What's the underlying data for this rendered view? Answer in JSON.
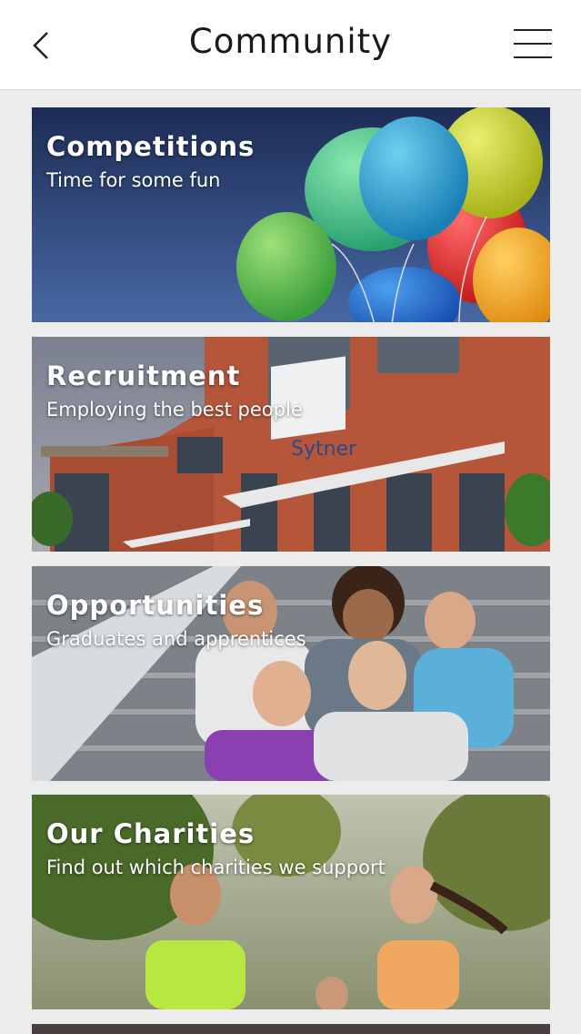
{
  "header": {
    "title": "Community",
    "back_icon": "chevron-left-icon",
    "menu_icon": "hamburger-menu-icon"
  },
  "cards": [
    {
      "title": "Competitions",
      "subtitle": "Time for some fun"
    },
    {
      "title": "Recruitment",
      "subtitle": "Employing the best people",
      "sign": "Sytner"
    },
    {
      "title": "Opportunities",
      "subtitle": "Graduates and apprentices"
    },
    {
      "title": "Our Charities",
      "subtitle": "Find out which charities we support"
    }
  ]
}
